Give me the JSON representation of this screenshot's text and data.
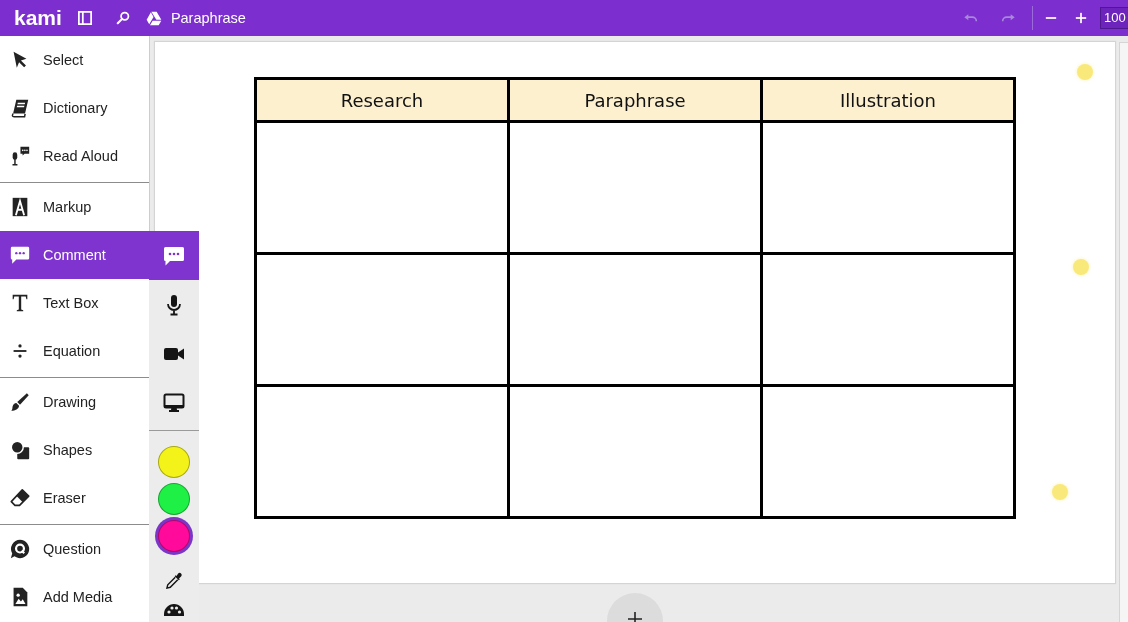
{
  "top_bar": {
    "logo": "kami",
    "document_title": "Paraphrase",
    "history": [
      {
        "kind": "undo",
        "disabled": true
      },
      {
        "kind": "redo",
        "disabled": true
      }
    ],
    "zoom": "100"
  },
  "tool_groups": [
    {
      "items": [
        {
          "kind": "pointer",
          "label": "Select",
          "selected": false
        },
        {
          "kind": "book",
          "label": "Dictionary",
          "selected": false
        },
        {
          "kind": "speaker",
          "label": "Read Aloud",
          "selected": false
        }
      ]
    },
    {
      "items": [
        {
          "kind": "markup",
          "label": "Markup",
          "selected": false
        },
        {
          "kind": "comment",
          "label": "Comment",
          "selected": true
        },
        {
          "kind": "text",
          "label": "Text Box",
          "selected": false
        },
        {
          "kind": "equation",
          "label": "Equation",
          "selected": false
        }
      ]
    },
    {
      "items": [
        {
          "kind": "brush",
          "label": "Drawing",
          "selected": false
        },
        {
          "kind": "shapes",
          "label": "Shapes",
          "selected": false
        },
        {
          "kind": "eraser",
          "label": "Eraser",
          "selected": false
        }
      ]
    },
    {
      "items": [
        {
          "kind": "question",
          "label": "Question",
          "selected": false
        },
        {
          "kind": "media",
          "label": "Add Media",
          "selected": false
        }
      ]
    }
  ],
  "comment_panel": {
    "options": [
      {
        "kind": "text",
        "selected": true
      },
      {
        "kind": "voice",
        "selected": false
      },
      {
        "kind": "video",
        "selected": false
      },
      {
        "kind": "screen",
        "selected": false
      }
    ],
    "colors": [
      {
        "color": "#f3f31a",
        "selected": false
      },
      {
        "color": "#1ef046",
        "selected": false
      },
      {
        "color": "#ff0a9a",
        "selected": true
      }
    ]
  },
  "document": {
    "table": {
      "columns": [
        "Research",
        "Paraphrase",
        "Illustration"
      ],
      "rows": [
        {
          "kind": "blank"
        },
        {
          "kind": "blank"
        },
        {
          "kind": "blank"
        }
      ]
    },
    "comment_markers": [
      {
        "kind": "dot"
      },
      {
        "kind": "dot"
      },
      {
        "kind": "dot"
      }
    ]
  }
}
